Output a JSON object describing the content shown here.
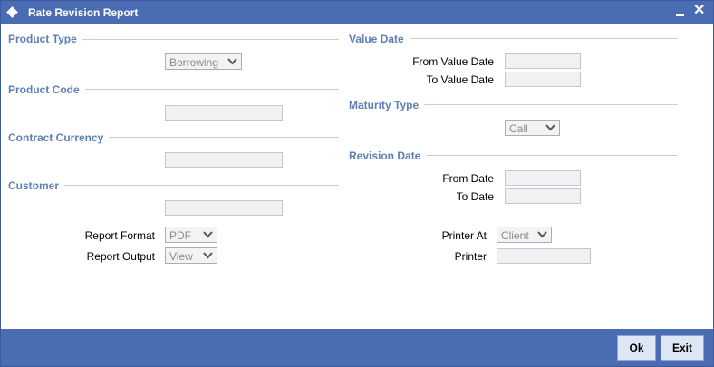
{
  "window": {
    "title": "Rate Revision Report"
  },
  "sections": {
    "product_type": "Product Type",
    "product_code": "Product Code",
    "contract_currency": "Contract Currency",
    "customer": "Customer",
    "value_date": "Value Date",
    "maturity_type": "Maturity Type",
    "revision_date": "Revision Date"
  },
  "fields": {
    "product_type_select": "Borrowing",
    "product_code_value": "",
    "contract_currency_value": "",
    "customer_value": "",
    "report_format_label": "Report Format",
    "report_format_value": "PDF",
    "report_output_label": "Report Output",
    "report_output_value": "View",
    "from_value_date_label": "From Value Date",
    "from_value_date_value": "",
    "to_value_date_label": "To Value Date",
    "to_value_date_value": "",
    "maturity_type_value": "Call",
    "from_date_label": "From Date",
    "from_date_value": "",
    "to_date_label": "To Date",
    "to_date_value": "",
    "printer_at_label": "Printer At",
    "printer_at_value": "Client",
    "printer_label": "Printer",
    "printer_value": ""
  },
  "buttons": {
    "ok": "Ok",
    "exit": "Exit"
  },
  "colors": {
    "titlebar": "#4a6cb3",
    "section_heading": "#5e7fb6",
    "button_face": "#dce6f4"
  }
}
